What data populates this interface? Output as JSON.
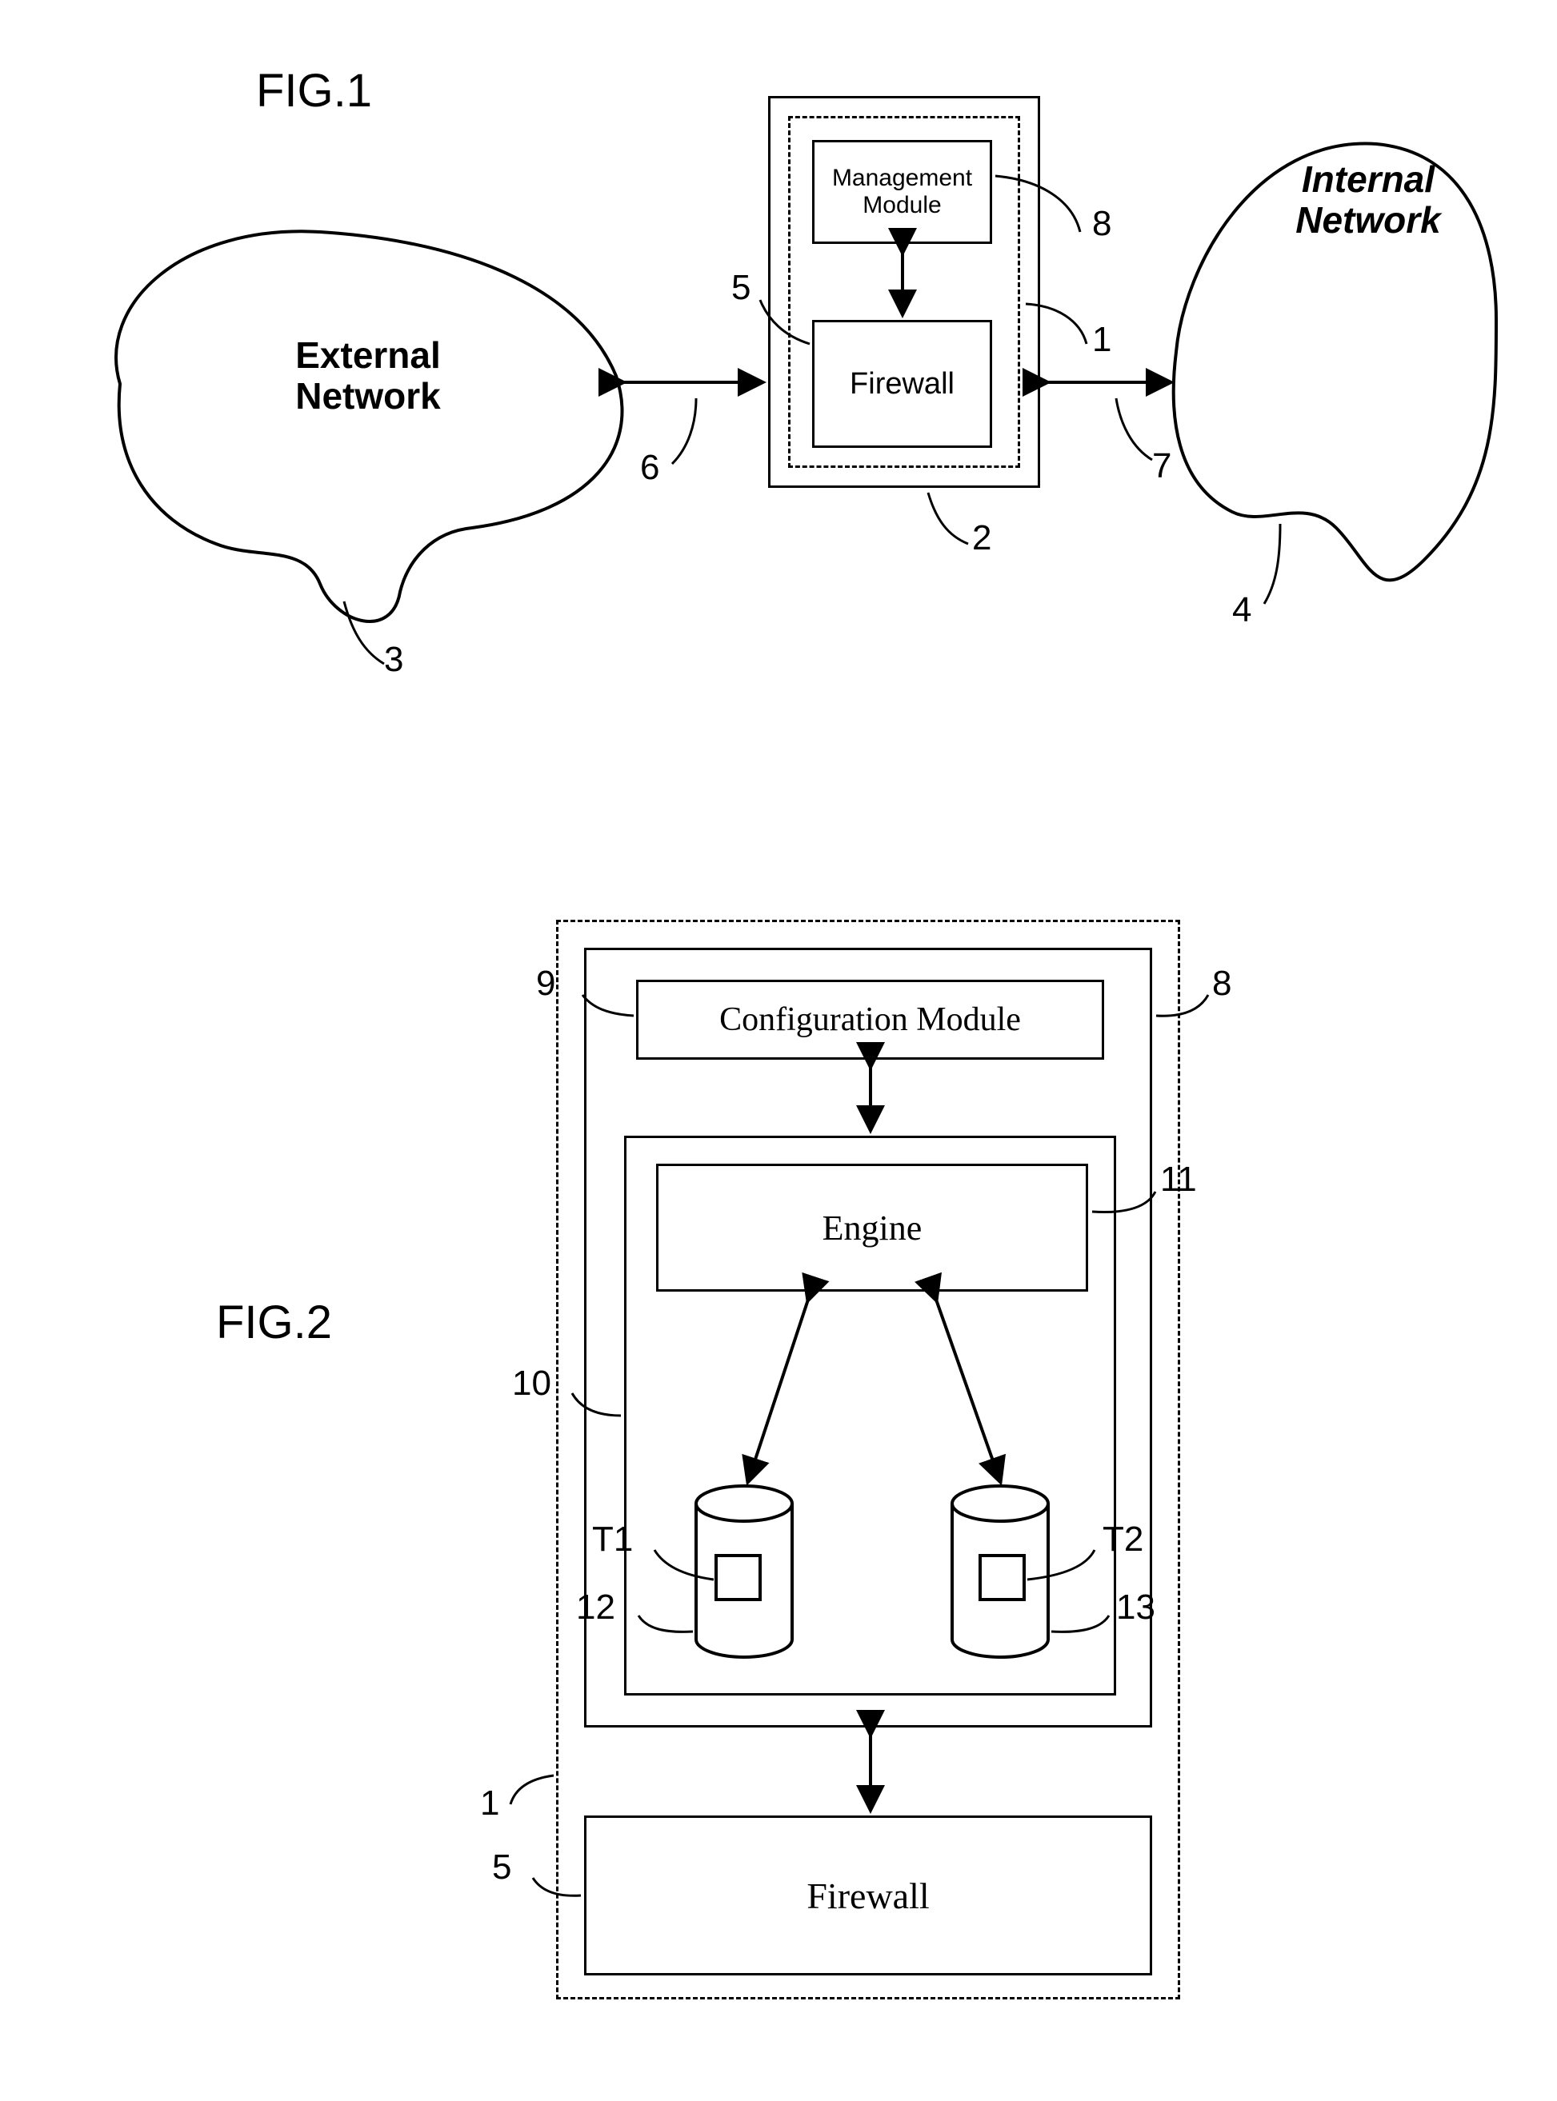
{
  "fig1": {
    "title": "FIG.1",
    "external_network": "External\nNetwork",
    "internal_network": "Internal\nNetwork",
    "management_module": "Management\nModule",
    "firewall": "Firewall",
    "labels": {
      "n1": "1",
      "n2": "2",
      "n3": "3",
      "n4": "4",
      "n5": "5",
      "n6": "6",
      "n7": "7",
      "n8": "8"
    }
  },
  "fig2": {
    "title": "FIG.2",
    "configuration_module": "Configuration Module",
    "engine": "Engine",
    "firewall": "Firewall",
    "labels": {
      "n1": "1",
      "n5": "5",
      "n8": "8",
      "n9": "9",
      "n10": "10",
      "n11": "11",
      "n12": "12",
      "n13": "13",
      "t1": "T1",
      "t2": "T2"
    }
  }
}
